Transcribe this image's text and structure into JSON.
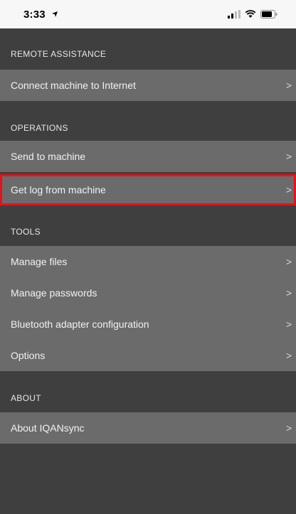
{
  "status_bar": {
    "time": "3:33",
    "icons": [
      "location-arrow-icon",
      "signal-icon",
      "wifi-icon",
      "battery-icon"
    ]
  },
  "menu": {
    "remote_assistance": {
      "header": "REMOTE ASSISTANCE",
      "items": [
        {
          "label": "Connect machine to Internet"
        }
      ]
    },
    "operations": {
      "header": "OPERATIONS",
      "items": [
        {
          "label": "Send to machine"
        },
        {
          "label": "Get log from machine"
        }
      ]
    },
    "tools": {
      "header": "TOOLS",
      "items": [
        {
          "label": "Manage files"
        },
        {
          "label": "Manage passwords"
        },
        {
          "label": "Bluetooth adapter configuration"
        },
        {
          "label": "Options"
        }
      ]
    },
    "about": {
      "header": "ABOUT",
      "items": [
        {
          "label": "About IQANsync"
        }
      ]
    },
    "chevron": ">"
  },
  "colors": {
    "background": "#3f3f3f",
    "row": "#6b6b6b",
    "highlight": "#e3121b"
  }
}
